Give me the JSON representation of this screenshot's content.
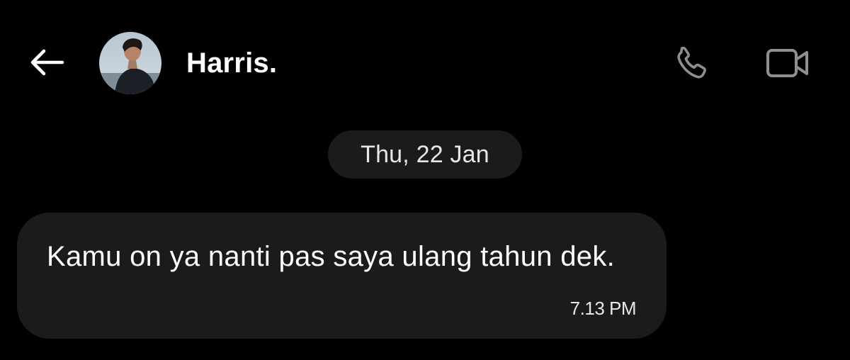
{
  "header": {
    "back_icon": "arrow-left-icon",
    "contact_name": "Harris.",
    "avatar_alt": "profile photo",
    "call_icon": "phone-icon",
    "video_icon": "video-camera-icon"
  },
  "conversation": {
    "date_separator": "Thu, 22 Jan",
    "messages": [
      {
        "text": "Kamu on ya nanti pas saya ulang tahun dek.",
        "time": "7.13 PM",
        "direction": "incoming"
      }
    ]
  },
  "colors": {
    "background": "#000000",
    "bubble": "#1b1b1d",
    "text": "#ffffff",
    "icon": "#8e8e93"
  }
}
